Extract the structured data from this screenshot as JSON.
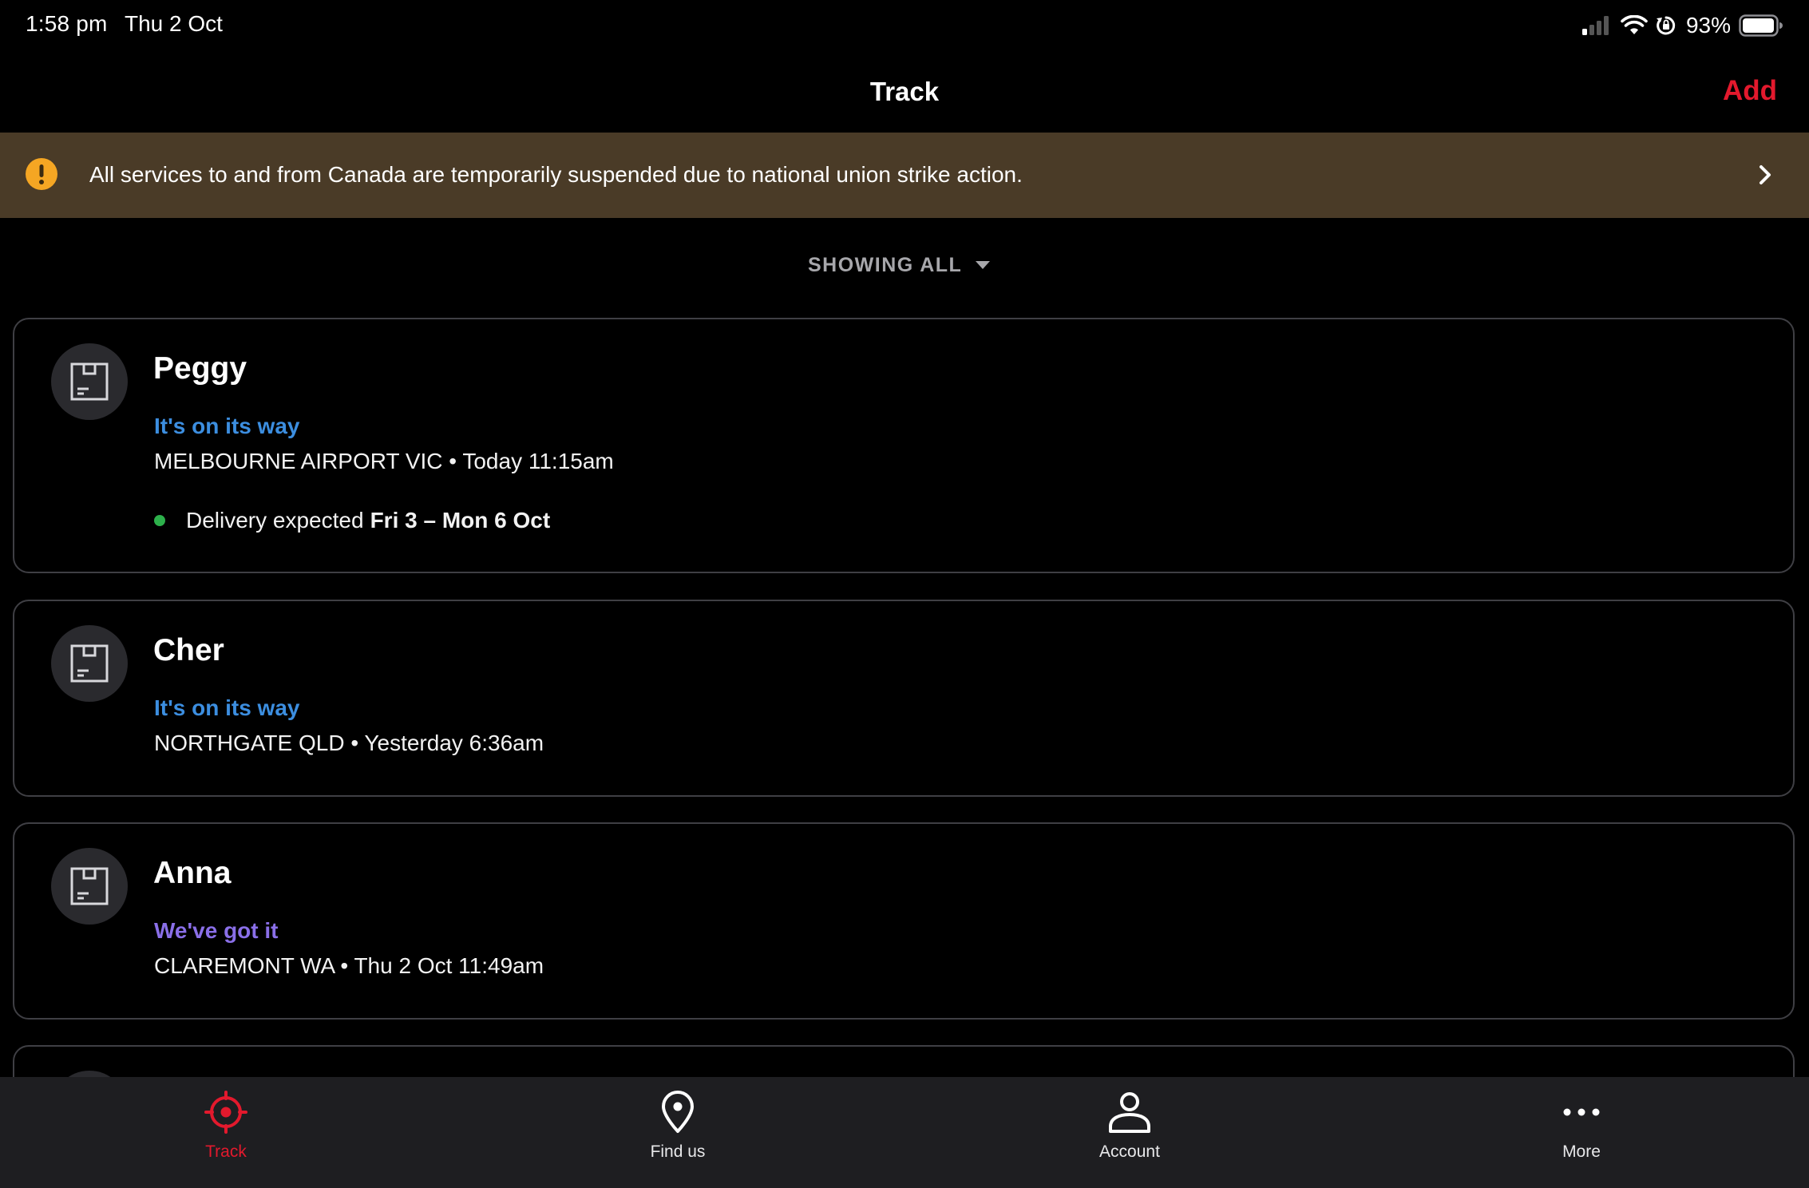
{
  "status_bar": {
    "time": "1:58 pm",
    "date": "Thu 2 Oct",
    "battery": "93%"
  },
  "nav": {
    "title": "Track",
    "add_label": "Add"
  },
  "alert": {
    "text": "All services to and from Canada are temporarily suspended due to national union strike action."
  },
  "filter": {
    "label": "SHOWING ALL"
  },
  "parcels": [
    {
      "name": "Peggy",
      "status": "It's on its way",
      "location": "MELBOURNE AIRPORT VIC • Today 11:15am",
      "delivery_prefix": "Delivery expected",
      "delivery_range": "Fri 3 – Mon 6 Oct"
    },
    {
      "name": "Cher",
      "status": "It's on its way",
      "location": "NORTHGATE QLD • Yesterday 6:36am"
    },
    {
      "name": "Anna",
      "status": "We've got it",
      "location": "CLAREMONT WA • Thu 2 Oct 11:49am"
    }
  ],
  "colors": {
    "accent": "#e3192d",
    "status_on_its_way": "#3c8ee0",
    "status_got_it": "#8a6fe8",
    "alert_bg": "#4a3b27",
    "alert_icon": "#f5a623",
    "delivery_dot": "#2db04b"
  },
  "tabs": [
    {
      "label": "Track",
      "icon": "target-icon",
      "active": true
    },
    {
      "label": "Find us",
      "icon": "location-pin-icon",
      "active": false
    },
    {
      "label": "Account",
      "icon": "person-icon",
      "active": false
    },
    {
      "label": "More",
      "icon": "more-dots-icon",
      "active": false
    }
  ]
}
